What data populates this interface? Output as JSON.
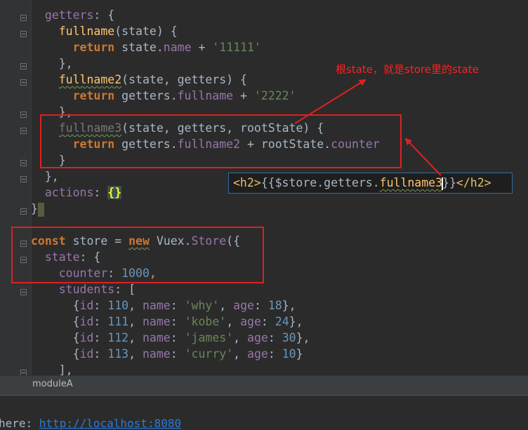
{
  "editor": {
    "lines": {
      "getters": {
        "key": "getters",
        "rest": ": {"
      },
      "fullname": {
        "name": "fullname",
        "params": "(state) {"
      },
      "fullname_return": {
        "kw": "return",
        "obj": " state.",
        "prop": "name",
        "op": " + ",
        "str": "'11111'"
      },
      "close1": "},",
      "fullname2": {
        "name": "fullname2",
        "params": "(state, getters) {"
      },
      "fullname2_return": {
        "kw": "return",
        "obj": " getters.",
        "prop": "fullname",
        "op": " + ",
        "str": "'2222'"
      },
      "close2": "},",
      "fullname3": {
        "name": "fullname3",
        "params": "(state, getters, rootState) {"
      },
      "fullname3_return": {
        "kw": "return",
        "obj": " getters.",
        "prop": "fullname2",
        "op": " + rootState.",
        "prop2": "counter"
      },
      "close3": "}",
      "close_getters": "},",
      "actions": {
        "key": "actions",
        "rest": ": ",
        "braces": "{}"
      },
      "close_module": "}",
      "store_decl": {
        "kw1": "const",
        "name": " store = ",
        "kw2": "new",
        "cls": " Vuex.",
        "fn": "Store",
        "rest": "({"
      },
      "state": {
        "key": "state",
        "rest": ": {"
      },
      "counter": {
        "key": "counter",
        "rest": ": ",
        "num": "1000",
        "end": ","
      },
      "students": {
        "key": "students",
        "rest": ": ["
      },
      "student_rows": [
        {
          "id": "110",
          "name": "'why'",
          "age": "18",
          "end": "},"
        },
        {
          "id": "111",
          "name": "'kobe'",
          "age": "24",
          "end": "},"
        },
        {
          "id": "112",
          "name": "'james'",
          "age": "30",
          "end": "},"
        },
        {
          "id": "113",
          "name": "'curry'",
          "age": "10",
          "end": "}"
        }
      ],
      "close_students": "],"
    },
    "student_labels": {
      "open": "{",
      "id_key": "id",
      "name_key": "name",
      "age_key": "age",
      "sep": ": ",
      "comma": ", "
    }
  },
  "annotation": {
    "text": "根state，就是store里的state",
    "color": "#ff2020"
  },
  "popup": {
    "open_tag": "<h2>",
    "mustache_open": "{{",
    "store_part": "$store.getters.",
    "fn_name": "fullname3",
    "mustache_close": "}}",
    "close_tag": "</h2>"
  },
  "breadcrumb": {
    "label": "moduleA"
  },
  "terminal": {
    "prefix": "here: ",
    "url": "http://localhost:8080"
  },
  "colors": {
    "background": "#2b2b2b",
    "keyword": "#cc7832",
    "function": "#ffc66d",
    "string": "#6a8759",
    "number": "#6897bb",
    "property": "#9876aa",
    "annotation_red": "#e02020"
  }
}
